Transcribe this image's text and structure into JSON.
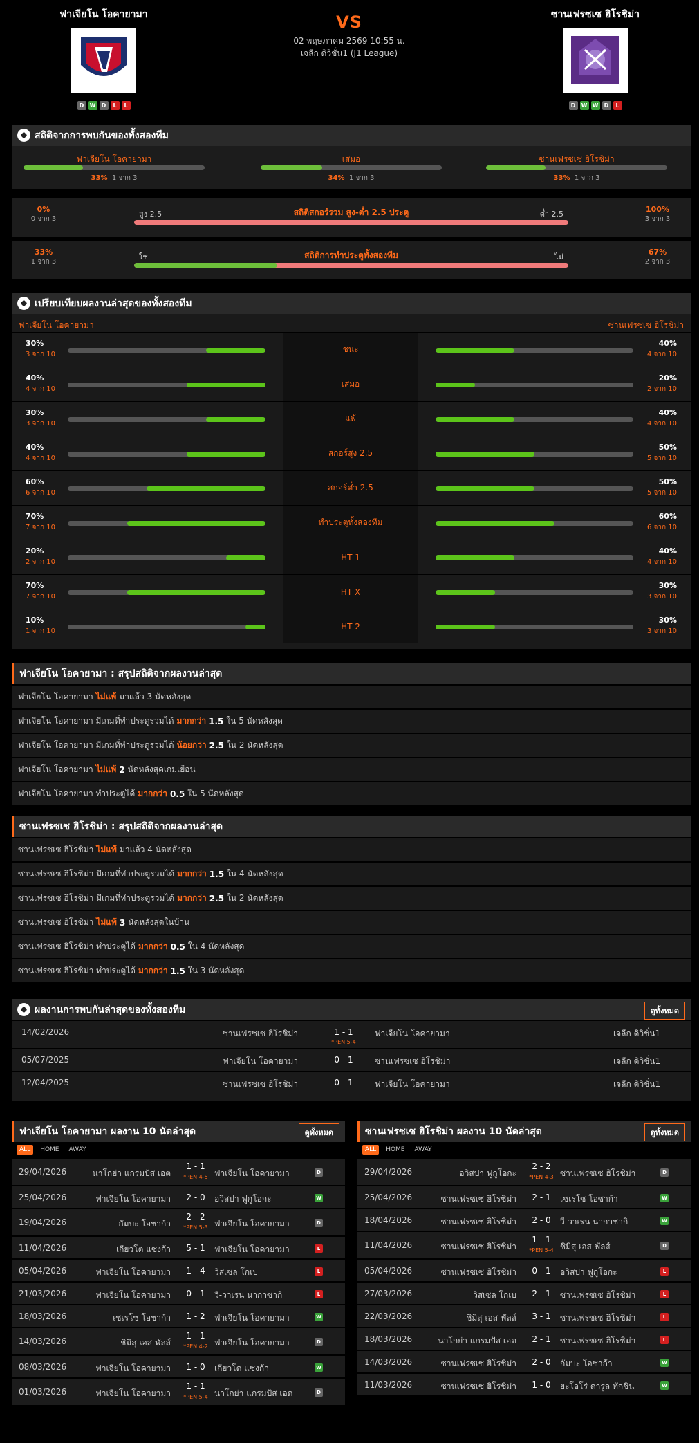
{
  "header": {
    "home": {
      "name": "ฟาเจียโน โอคายามา",
      "form": [
        "D",
        "W",
        "D",
        "L",
        "L"
      ]
    },
    "away": {
      "name": "ซานเฟรซเซ ฮิโรชิม่า",
      "form": [
        "D",
        "W",
        "W",
        "D",
        "L"
      ]
    },
    "vs": "VS",
    "datetime": "02 พฤษภาคม 2569 10:55 น.",
    "league": "เจลีก ดิวิชั่น1 (J1 League)"
  },
  "h2h_stats": {
    "title": "สถิติจากการพบกันของทั้งสองทีม",
    "cells": [
      {
        "label": "ฟาเจียโน โอคายามา",
        "pct": "33%",
        "count": "1 จาก 3",
        "fill": 0.33
      },
      {
        "label": "เสมอ",
        "pct": "34%",
        "count": "1 จาก 3",
        "fill": 0.34
      },
      {
        "label": "ซานเฟรซเซ ฮิโรชิม่า",
        "pct": "33%",
        "count": "1 จาก 3",
        "fill": 0.33
      }
    ],
    "ou": {
      "title": "สถิติสกอร์รวม สูง-ต่ำ 2.5 ประตู",
      "left_label": "สูง 2.5",
      "right_label": "ต่ำ 2.5",
      "left_pct": "0%",
      "left_count": "0 จาก 3",
      "right_pct": "100%",
      "right_count": "3 จาก 3",
      "fill": 0
    },
    "btts": {
      "title": "สถิติการทำประตูทั้งสองทีม",
      "left_label": "ใช่",
      "right_label": "ไม่",
      "left_pct": "33%",
      "left_count": "1 จาก 3",
      "right_pct": "67%",
      "right_count": "2 จาก 3",
      "fill": 0.33
    }
  },
  "compare": {
    "title": "เปรียบเทียบผลงานล่าสุดของทั้งสองทีม",
    "home": "ฟาเจียโน โอคายามา",
    "away": "ซานเฟรซเซ ฮิโรชิม่า",
    "rows": [
      {
        "label": "ชนะ",
        "lp": "30%",
        "lc": "3 จาก 10",
        "lf": 0.3,
        "rp": "40%",
        "rc": "4 จาก 10",
        "rf": 0.4
      },
      {
        "label": "เสมอ",
        "lp": "40%",
        "lc": "4 จาก 10",
        "lf": 0.4,
        "rp": "20%",
        "rc": "2 จาก 10",
        "rf": 0.2
      },
      {
        "label": "แพ้",
        "lp": "30%",
        "lc": "3 จาก 10",
        "lf": 0.3,
        "rp": "40%",
        "rc": "4 จาก 10",
        "rf": 0.4
      },
      {
        "label": "สกอร์สูง 2.5",
        "lp": "40%",
        "lc": "4 จาก 10",
        "lf": 0.4,
        "rp": "50%",
        "rc": "5 จาก 10",
        "rf": 0.5
      },
      {
        "label": "สกอร์ต่ำ 2.5",
        "lp": "60%",
        "lc": "6 จาก 10",
        "lf": 0.6,
        "rp": "50%",
        "rc": "5 จาก 10",
        "rf": 0.5
      },
      {
        "label": "ทำประตูทั้งสองทีม",
        "lp": "70%",
        "lc": "7 จาก 10",
        "lf": 0.7,
        "rp": "60%",
        "rc": "6 จาก 10",
        "rf": 0.6
      },
      {
        "label": "HT 1",
        "lp": "20%",
        "lc": "2 จาก 10",
        "lf": 0.2,
        "rp": "40%",
        "rc": "4 จาก 10",
        "rf": 0.4
      },
      {
        "label": "HT X",
        "lp": "70%",
        "lc": "7 จาก 10",
        "lf": 0.7,
        "rp": "30%",
        "rc": "3 จาก 10",
        "rf": 0.3
      },
      {
        "label": "HT 2",
        "lp": "10%",
        "lc": "1 จาก 10",
        "lf": 0.1,
        "rp": "30%",
        "rc": "3 จาก 10",
        "rf": 0.3
      }
    ]
  },
  "home_summary": {
    "title": "ฟาเจียโน โอคายามา : สรุปสถิติจากผลงานล่าสุด",
    "rows": [
      {
        "pre": "ฟาเจียโน โอคายามา",
        "hl": "ไม่แพ้",
        "num": "",
        "post": "มาแล้ว 3 นัดหลังสุด"
      },
      {
        "pre": "ฟาเจียโน โอคายามา มีเกมที่ทำประตูรวมได้",
        "hl": "มากกว่า",
        "num": "1.5",
        "post": "ใน 5 นัดหลังสุด"
      },
      {
        "pre": "ฟาเจียโน โอคายามา มีเกมที่ทำประตูรวมได้",
        "hl": "น้อยกว่า",
        "num": "2.5",
        "post": "ใน 2 นัดหลังสุด"
      },
      {
        "pre": "ฟาเจียโน โอคายามา",
        "hl": "ไม่แพ้",
        "num": "2",
        "post": "นัดหลังสุดเกมเยือน"
      },
      {
        "pre": "ฟาเจียโน โอคายามา ทำประตูได้",
        "hl": "มากกว่า",
        "num": "0.5",
        "post": "ใน 5 นัดหลังสุด"
      }
    ]
  },
  "away_summary": {
    "title": "ซานเฟรซเซ ฮิโรชิม่า : สรุปสถิติจากผลงานล่าสุด",
    "rows": [
      {
        "pre": "ซานเฟรซเซ ฮิโรชิม่า",
        "hl": "ไม่แพ้",
        "num": "",
        "post": "มาแล้ว 4 นัดหลังสุด"
      },
      {
        "pre": "ซานเฟรซเซ ฮิโรชิม่า มีเกมที่ทำประตูรวมได้",
        "hl": "มากกว่า",
        "num": "1.5",
        "post": "ใน 4 นัดหลังสุด"
      },
      {
        "pre": "ซานเฟรซเซ ฮิโรชิม่า มีเกมที่ทำประตูรวมได้",
        "hl": "มากกว่า",
        "num": "2.5",
        "post": "ใน 2 นัดหลังสุด"
      },
      {
        "pre": "ซานเฟรซเซ ฮิโรชิม่า",
        "hl": "ไม่แพ้",
        "num": "3",
        "post": "นัดหลังสุดในบ้าน"
      },
      {
        "pre": "ซานเฟรซเซ ฮิโรชิม่า ทำประตูได้",
        "hl": "มากกว่า",
        "num": "0.5",
        "post": "ใน 4 นัดหลังสุด"
      },
      {
        "pre": "ซานเฟรซเซ ฮิโรชิม่า ทำประตูได้",
        "hl": "มากกว่า",
        "num": "1.5",
        "post": "ใน 3 นัดหลังสุด"
      }
    ]
  },
  "h2h_results": {
    "title": "ผลงานการพบกันล่าสุดของทั้งสองทีม",
    "see_all": "ดูทั้งหมด",
    "rows": [
      {
        "date": "14/02/2026",
        "home": "ซานเฟรซเซ ฮิโรชิม่า",
        "score": "1 - 1",
        "pen": "*PEN 5-4",
        "away": "ฟาเจียโน โอคายามา",
        "league": "เจลีก ดิวิชั่น1"
      },
      {
        "date": "05/07/2025",
        "home": "ฟาเจียโน โอคายามา",
        "score": "0 - 1",
        "pen": "",
        "away": "ซานเฟรซเซ ฮิโรชิม่า",
        "league": "เจลีก ดิวิชั่น1"
      },
      {
        "date": "12/04/2025",
        "home": "ซานเฟรซเซ ฮิโรชิม่า",
        "score": "0 - 1",
        "pen": "",
        "away": "ฟาเจียโน โอคายามา",
        "league": "เจลีก ดิวิชั่น1"
      }
    ]
  },
  "tabs": [
    "ALL",
    "HOME",
    "AWAY"
  ],
  "home_last10": {
    "title": "ฟาเจียโน โอคายามา ผลงาน 10 นัดล่าสุด",
    "see_all": "ดูทั้งหมด",
    "rows": [
      {
        "date": "29/04/2026",
        "home": "นาโกย่า แกรมปัส เอต",
        "score": "1 - 1",
        "pen": "*PEN 4-5",
        "away": "ฟาเจียโน โอคายามา",
        "res": "D"
      },
      {
        "date": "25/04/2026",
        "home": "ฟาเจียโน โอคายามา",
        "score": "2 - 0",
        "pen": "",
        "away": "อวิสปา ฟูกูโอกะ",
        "res": "W"
      },
      {
        "date": "19/04/2026",
        "home": "กัมบะ โอซาก้า",
        "score": "2 - 2",
        "pen": "*PEN 5-3",
        "away": "ฟาเจียโน โอคายามา",
        "res": "D"
      },
      {
        "date": "11/04/2026",
        "home": "เกียวโต แซงก้า",
        "score": "5 - 1",
        "pen": "",
        "away": "ฟาเจียโน โอคายามา",
        "res": "L"
      },
      {
        "date": "05/04/2026",
        "home": "ฟาเจียโน โอคายามา",
        "score": "1 - 4",
        "pen": "",
        "away": "วิสเซล โกเบ",
        "res": "L"
      },
      {
        "date": "21/03/2026",
        "home": "ฟาเจียโน โอคายามา",
        "score": "0 - 1",
        "pen": "",
        "away": "วี-วาเรน นากาซากิ",
        "res": "L"
      },
      {
        "date": "18/03/2026",
        "home": "เซเรโซ โอซาก้า",
        "score": "1 - 2",
        "pen": "",
        "away": "ฟาเจียโน โอคายามา",
        "res": "W"
      },
      {
        "date": "14/03/2026",
        "home": "ชิมิสุ เอส-พัลส์",
        "score": "1 - 1",
        "pen": "*PEN 4-2",
        "away": "ฟาเจียโน โอคายามา",
        "res": "D"
      },
      {
        "date": "08/03/2026",
        "home": "ฟาเจียโน โอคายามา",
        "score": "1 - 0",
        "pen": "",
        "away": "เกียวโต แซงก้า",
        "res": "W"
      },
      {
        "date": "01/03/2026",
        "home": "ฟาเจียโน โอคายามา",
        "score": "1 - 1",
        "pen": "*PEN 5-4",
        "away": "นาโกย่า แกรมปัส เอต",
        "res": "D"
      }
    ]
  },
  "away_last10": {
    "title": "ซานเฟรซเซ ฮิโรชิม่า ผลงาน 10 นัดล่าสุด",
    "see_all": "ดูทั้งหมด",
    "rows": [
      {
        "date": "29/04/2026",
        "home": "อวิสปา ฟูกูโอกะ",
        "score": "2 - 2",
        "pen": "*PEN 4-3",
        "away": "ซานเฟรซเซ ฮิโรชิม่า",
        "res": "D"
      },
      {
        "date": "25/04/2026",
        "home": "ซานเฟรซเซ ฮิโรชิม่า",
        "score": "2 - 1",
        "pen": "",
        "away": "เซเรโซ โอซาก้า",
        "res": "W"
      },
      {
        "date": "18/04/2026",
        "home": "ซานเฟรซเซ ฮิโรชิม่า",
        "score": "2 - 0",
        "pen": "",
        "away": "วี-วาเรน นากาซากิ",
        "res": "W"
      },
      {
        "date": "11/04/2026",
        "home": "ซานเฟรซเซ ฮิโรชิม่า",
        "score": "1 - 1",
        "pen": "*PEN 5-4",
        "away": "ชิมิสุ เอส-พัลส์",
        "res": "D"
      },
      {
        "date": "05/04/2026",
        "home": "ซานเฟรซเซ ฮิโรชิม่า",
        "score": "0 - 1",
        "pen": "",
        "away": "อวิสปา ฟูกูโอกะ",
        "res": "L"
      },
      {
        "date": "27/03/2026",
        "home": "วิสเซล โกเบ",
        "score": "2 - 1",
        "pen": "",
        "away": "ซานเฟรซเซ ฮิโรชิม่า",
        "res": "L"
      },
      {
        "date": "22/03/2026",
        "home": "ชิมิสุ เอส-พัลส์",
        "score": "3 - 1",
        "pen": "",
        "away": "ซานเฟรซเซ ฮิโรชิม่า",
        "res": "L"
      },
      {
        "date": "18/03/2026",
        "home": "นาโกย่า แกรมปัส เอต",
        "score": "2 - 1",
        "pen": "",
        "away": "ซานเฟรซเซ ฮิโรชิม่า",
        "res": "L"
      },
      {
        "date": "14/03/2026",
        "home": "ซานเฟรซเซ ฮิโรชิม่า",
        "score": "2 - 0",
        "pen": "",
        "away": "กัมบะ โอซาก้า",
        "res": "W"
      },
      {
        "date": "11/03/2026",
        "home": "ซานเฟรซเซ ฮิโรชิม่า",
        "score": "1 - 0",
        "pen": "",
        "away": "ยะโอโร่ ดารูล ทักชิน",
        "res": "W"
      }
    ]
  }
}
